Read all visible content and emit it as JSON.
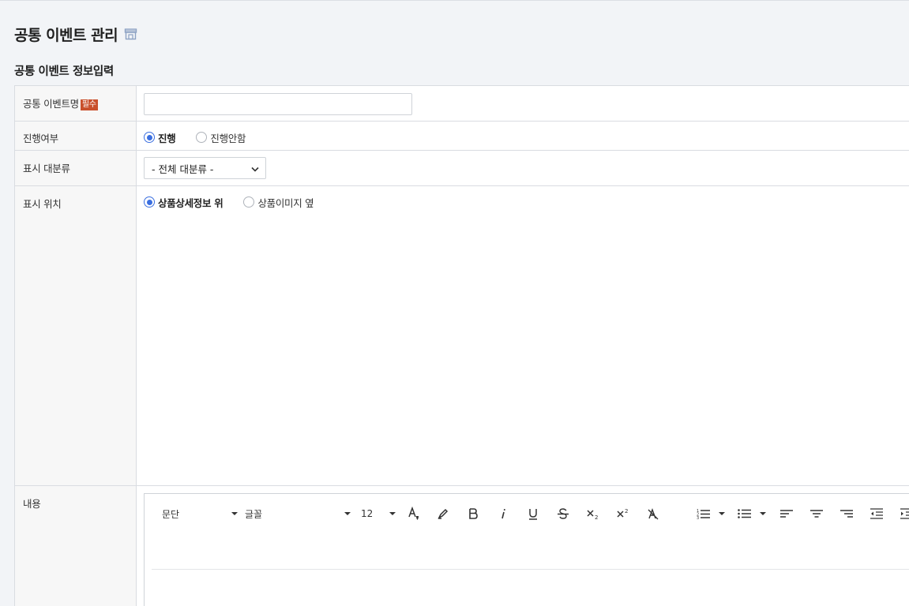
{
  "page": {
    "title": "공통 이벤트 관리",
    "section_title": "공통 이벤트 정보입력"
  },
  "form": {
    "event_name": {
      "label": "공통 이벤트명",
      "required_badge": "필수",
      "value": ""
    },
    "progress": {
      "label": "진행여부",
      "options": [
        "진행",
        "진행안함"
      ],
      "selected": "진행"
    },
    "category": {
      "label": "표시 대분류",
      "selected": "- 전체 대분류 -"
    },
    "position": {
      "label": "표시 위치",
      "options": [
        "상품상세정보 위",
        "상품이미지 옆"
      ],
      "selected": "상품상세정보 위"
    },
    "content": {
      "label": "내용"
    }
  },
  "editor": {
    "paragraph": "문단",
    "font": "글꼴",
    "size": "12",
    "buttons": [
      "font-color-icon",
      "highlight-icon",
      "bold-icon",
      "italic-icon",
      "underline-icon",
      "strikethrough-icon",
      "subscript-icon",
      "superscript-icon",
      "clear-format-icon",
      "numbered-list-icon",
      "bulleted-list-icon",
      "align-left-icon",
      "align-center-icon",
      "align-right-icon",
      "outdent-icon",
      "indent-icon"
    ]
  },
  "colors": {
    "accent": "#3b6fe0",
    "required": "#c9502c",
    "background": "#f2f4f7"
  }
}
